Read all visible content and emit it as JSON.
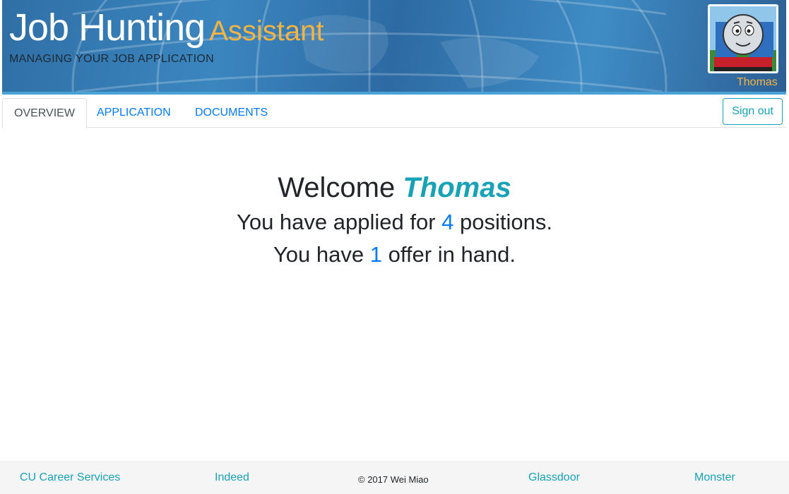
{
  "header": {
    "title_main": "Job Hunting",
    "title_accent": "Assistant",
    "subtitle": "MANAGING YOUR JOB APPLICATION",
    "user_name": "Thomas",
    "colors": {
      "accent": "#f5b342",
      "banner": "#3b86bf"
    }
  },
  "nav": {
    "tabs": [
      {
        "label": "OVERVIEW",
        "active": true
      },
      {
        "label": "APPLICATION",
        "active": false
      },
      {
        "label": "DOCUMENTS",
        "active": false
      }
    ],
    "signout_label": "Sign out"
  },
  "main": {
    "welcome_prefix": "Welcome",
    "user_name": "Thomas",
    "applied_prefix": "You have applied for",
    "applied_count": "4",
    "applied_suffix": "positions.",
    "offer_prefix": "You have",
    "offer_count": "1",
    "offer_suffix": "offer in hand."
  },
  "footer": {
    "links": [
      "CU Career Services",
      "Indeed",
      "Glassdoor",
      "Monster"
    ],
    "copyright": "© 2017 Wei Miao"
  },
  "icons": {
    "avatar": "thomas-train-avatar"
  }
}
